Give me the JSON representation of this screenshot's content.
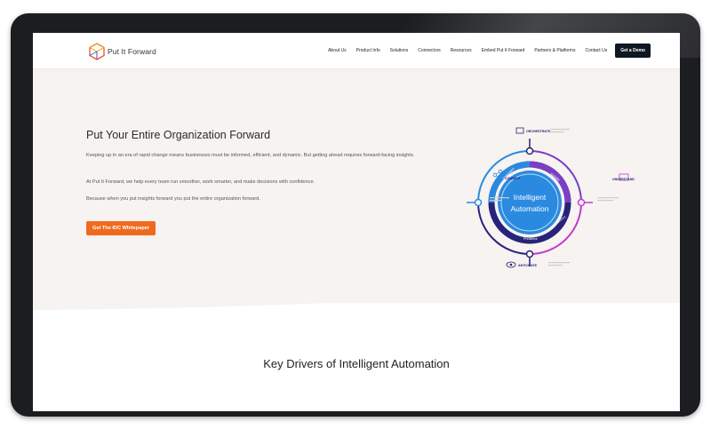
{
  "brand": {
    "name": "Put It Forward"
  },
  "nav": {
    "links": [
      "About Us",
      "Product Info",
      "Solutions",
      "Connectors",
      "Resources",
      "Embed Put It Forward",
      "Partners & Platforms",
      "Contact Us"
    ],
    "cta": "Get a Demo"
  },
  "hero": {
    "title": "Put Your Entire Organization Forward",
    "paragraphs": [
      "Keeping up in an era of rapid change means businesses must be informed, efficient, and dynamic. But getting ahead requires forward-facing insights.",
      "At Put It Forward, we help every team run smoother, work smarter, and make decisions with confidence.",
      "Because when you put insights forward you put the entire organization forward."
    ],
    "cta": "Get The IDC Whitepaper"
  },
  "diagram": {
    "center_title": "Intelligent Automation",
    "ring_words": [
      "Integration",
      "Visibility",
      "Efficiency",
      "Predictive"
    ],
    "nodes": [
      "ORCHESTRATE",
      "CONNECT",
      "UNDERSTAND",
      "ANTICIPATE"
    ],
    "colors": {
      "blue": "#2a8ae0",
      "purple": "#7a3fc4",
      "magenta": "#c13bd0",
      "navy": "#27237a"
    }
  },
  "section": {
    "title": "Key Drivers of Intelligent Automation"
  }
}
